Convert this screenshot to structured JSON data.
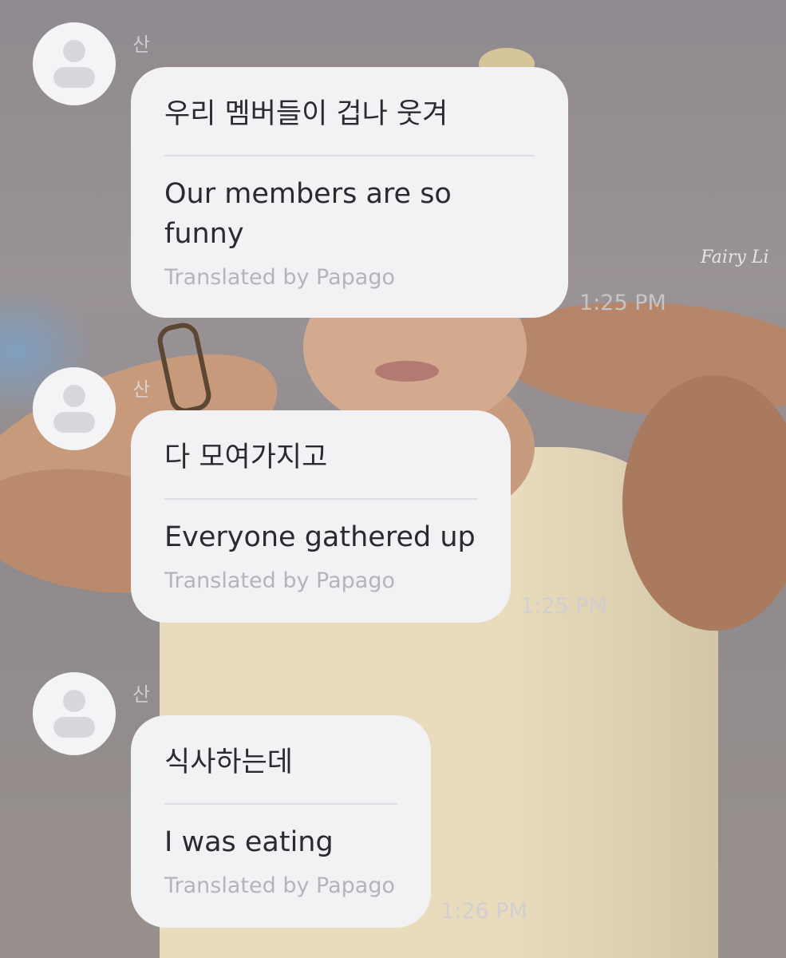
{
  "watermark": "Fairy Li",
  "messages": [
    {
      "sender": "산",
      "avatar_icon": "person-icon",
      "original": "우리 멤버들이 겁나 웃겨",
      "translation": "Our members are so funny",
      "credit": "Translated by Papago",
      "time": "1:25 PM"
    },
    {
      "sender": "산",
      "avatar_icon": "person-icon",
      "original": "다 모여가지고",
      "translation": "Everyone gathered up",
      "credit": "Translated by Papago",
      "time": "1:25 PM"
    },
    {
      "sender": "산",
      "avatar_icon": "person-icon",
      "original": "식사하는데",
      "translation": "I was eating",
      "credit": "Translated by Papago",
      "time": "1:26 PM"
    }
  ]
}
